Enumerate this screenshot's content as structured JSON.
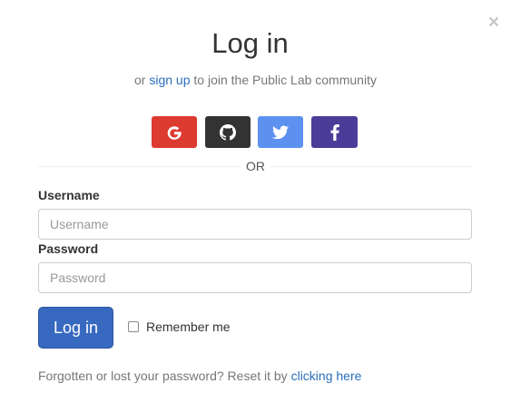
{
  "modal": {
    "close_glyph": "×",
    "title": "Log in",
    "subtitle_prefix": "or",
    "signup_link": "sign up",
    "subtitle_suffix": "to join the Public Lab community"
  },
  "social": [
    {
      "name": "google",
      "icon": "google-icon",
      "color": "#dd3b30"
    },
    {
      "name": "github",
      "icon": "github-icon",
      "color": "#333333"
    },
    {
      "name": "twitter",
      "icon": "twitter-icon",
      "color": "#5c91ef"
    },
    {
      "name": "facebook",
      "icon": "facebook-icon",
      "color": "#4b3c9a"
    }
  ],
  "divider_text": "OR",
  "form": {
    "username_label": "Username",
    "username_placeholder": "Username",
    "username_value": "",
    "password_label": "Password",
    "password_placeholder": "Password",
    "password_value": "",
    "login_button": "Log in",
    "remember_label": "Remember me",
    "remember_checked": false
  },
  "footer": {
    "forgot_text": "Forgotten or lost your password? Reset it by",
    "forgot_link": "clicking here"
  },
  "colors": {
    "link": "#2a6ebb",
    "primary_button": "#3869c0"
  }
}
